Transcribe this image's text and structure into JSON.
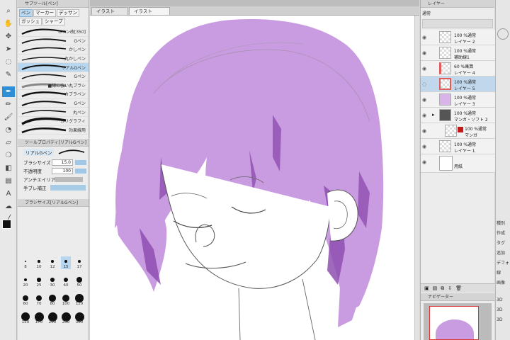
{
  "subtool": {
    "title": "サブツール[ペン]",
    "tabs": [
      "ペン",
      "マーカー",
      "デッサン",
      "ガッシュ",
      "シャープ"
    ],
    "brushes": [
      {
        "label": "Gペン改[350]"
      },
      {
        "label": "Gペン"
      },
      {
        "label": "かしペン"
      },
      {
        "label": "丸かしペン"
      },
      {
        "label": "リアルGペン",
        "selected": true
      },
      {
        "label": "Gペン"
      },
      {
        "label": "■線に強い丸ブラシ"
      },
      {
        "label": "カブラペン"
      },
      {
        "label": "Gペン"
      },
      {
        "label": "丸ペン"
      },
      {
        "label": "カリグラフィ"
      },
      {
        "label": "効果線用"
      }
    ]
  },
  "tool_property": {
    "title": "ツールプロパティ[リアルGペン]",
    "preset_name": "リアルGペン",
    "brush_size_label": "ブラシサイズ",
    "brush_size_value": "15.0",
    "opacity_label": "不透明度",
    "opacity_value": "100",
    "antialias_label": "アンチエイリアス",
    "stabilize_label": "手ブレ補正"
  },
  "brush_size_panel": {
    "title": "ブラシサイズ[リアルGペン]",
    "sizes": [
      "8",
      "10",
      "12",
      "15",
      "17",
      "20",
      "25",
      "30",
      "40",
      "50",
      "60",
      "70",
      "80",
      "100",
      "120",
      "150",
      "170",
      "200",
      "250",
      "300"
    ]
  },
  "doc_tabs": [
    "イラスト",
    "イラスト"
  ],
  "layer_panel": {
    "title": "レイヤー",
    "blend_mode": "通常",
    "layers": [
      {
        "line1": "100 %通常",
        "line2": "レイヤー 2"
      },
      {
        "line1": "100 %通常",
        "line2": "補助線1"
      },
      {
        "line1": "60 %乗算",
        "line2": "レイヤー 4"
      },
      {
        "line1": "100 %通常",
        "line2": "レイヤー 5",
        "selected": true
      },
      {
        "line1": "100 %通常",
        "line2": "レイヤー 3"
      },
      {
        "line1": "100 %通常",
        "line2": "マンガ・ソフト 2"
      },
      {
        "line1": "100 %通常",
        "line2": "マンガ"
      },
      {
        "line1": "100 %通常",
        "line2": "レイヤー 1"
      },
      {
        "line1": "",
        "line2": "用紙"
      }
    ]
  },
  "navigator_title": "ナビゲーター",
  "far_right": [
    "種別",
    "作成",
    "タグ",
    "追加",
    "デフォ",
    "線",
    "画像",
    "3D",
    "3D",
    "3D"
  ],
  "colors": {
    "accent": "#2d8fd5",
    "hair": "#c99be0",
    "hair_dark": "#8e4fb0",
    "selected_layer": "#c1d8ec"
  }
}
